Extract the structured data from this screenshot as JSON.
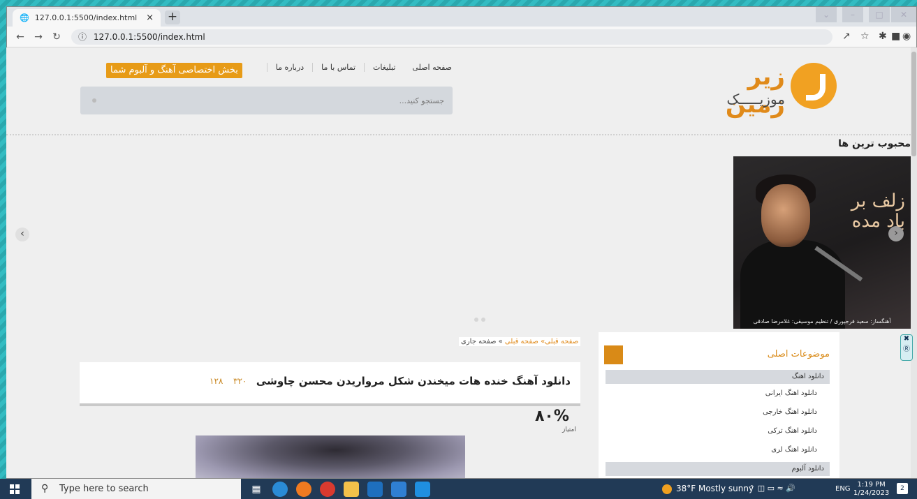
{
  "browser": {
    "tab_title": "127.0.0.1:5500/index.html",
    "tab_close": "×",
    "new_tab": "+",
    "url": "127.0.0.1:5500/index.html"
  },
  "site": {
    "logo_title": "زیر زمین",
    "logo_subtitle": "موزیـــــک",
    "nav": [
      "صفحه اصلی",
      "تبلیغات",
      "تماس با ما",
      "درباره ما"
    ],
    "cta": "بخش اختصاصی آهنگ و آلبوم شما",
    "search_placeholder": "جستجو کنید..."
  },
  "featured": {
    "title": "محبوب ترین ها",
    "art_calligraphy": "زلف بر باد مده",
    "art_caption": "آهنگساز: سعید فرجپوری / تنظیم موسیقی: غلامرضا صادقی"
  },
  "breadcrumb": {
    "link1": "صفحه قبلی»",
    "link2": "صفحه قبلی",
    "current": "» صفحه جاری"
  },
  "post": {
    "title": "دانلود آهنگ خنده هات میخندن شکل مرواریدن محسن چاوشی",
    "views": "۳۲۰",
    "comments": "۱۲۸",
    "rating": "۸۰%",
    "rating_label": "امتیاز"
  },
  "sidebar": {
    "title": "موضوعات اصلی",
    "categories": [
      {
        "label": "دانلود اهنگ"
      },
      {
        "label": "دانلود آلبوم"
      }
    ],
    "items": [
      "دانلود اهنگ ایرانی",
      "دانلود اهنگ خارجی",
      "دانلود اهنگ ترکی",
      "دانلود اهنگ لری"
    ]
  },
  "taskbar": {
    "search_placeholder": "Type here to search",
    "weather": "38°F  Mostly sunny",
    "lang": "ENG",
    "time": "1:19 PM",
    "date": "1/24/2023",
    "notifications": "2"
  },
  "colors": {
    "accent": "#e79b17",
    "taskbar": "#213a56"
  }
}
